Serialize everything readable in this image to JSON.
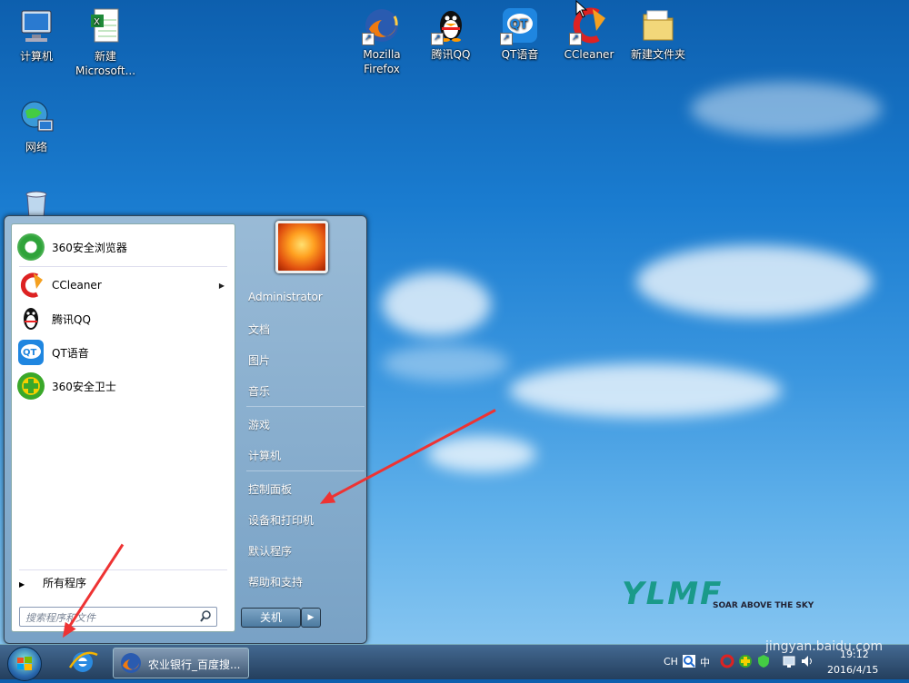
{
  "desktop": {
    "icons": [
      {
        "label": "计算机",
        "icon": "computer-icon"
      },
      {
        "label": "新建 Microsoft...",
        "icon": "excel-document-icon"
      },
      {
        "label": "网络",
        "icon": "network-icon"
      },
      {
        "label": "",
        "icon": "recycle-bin-icon"
      },
      {
        "label": "Mozilla Firefox",
        "icon": "firefox-icon"
      },
      {
        "label": "腾讯QQ",
        "icon": "qq-penguin-icon"
      },
      {
        "label": "QT语音",
        "icon": "qt-voice-icon"
      },
      {
        "label": "CCleaner",
        "icon": "ccleaner-icon"
      },
      {
        "label": "新建文件夹",
        "icon": "folder-icon"
      }
    ],
    "watermark_brand": "YLMF",
    "watermark_tagline": "SOAR ABOVE THE SKY"
  },
  "start_menu": {
    "programs": [
      {
        "label": "360安全浏览器",
        "icon": "360-browser-icon",
        "color": "#2fa33a"
      },
      {
        "label": "CCleaner",
        "icon": "ccleaner-icon",
        "color": "#d22",
        "submenu_arrow": "▶"
      },
      {
        "label": "腾讯QQ",
        "icon": "qq-penguin-icon",
        "color": "#111"
      },
      {
        "label": "QT语音",
        "icon": "qt-voice-icon",
        "color": "#1f7ad0"
      },
      {
        "label": "360安全卫士",
        "icon": "360-safe-guard-icon",
        "color": "#3aa82a"
      }
    ],
    "all_programs": "所有程序",
    "search_placeholder": "搜索程序和文件",
    "user_name": "Administrator",
    "right_items": [
      "文档",
      "图片",
      "音乐",
      "游戏",
      "计算机",
      "控制面板",
      "设备和打印机",
      "默认程序",
      "帮助和支持"
    ],
    "shutdown_label": "关机",
    "shutdown_arrow": "▶"
  },
  "taskbar": {
    "task_label": "农业银行_百度搜...",
    "language": "CH",
    "time": "19:12",
    "date": "2016/4/15",
    "ime_label": "中"
  },
  "colors": {
    "annotation_arrow": "#e33333",
    "desktop_sky": "#1a7cd0"
  },
  "overlay_watermark": "jingyan.baidu.com"
}
